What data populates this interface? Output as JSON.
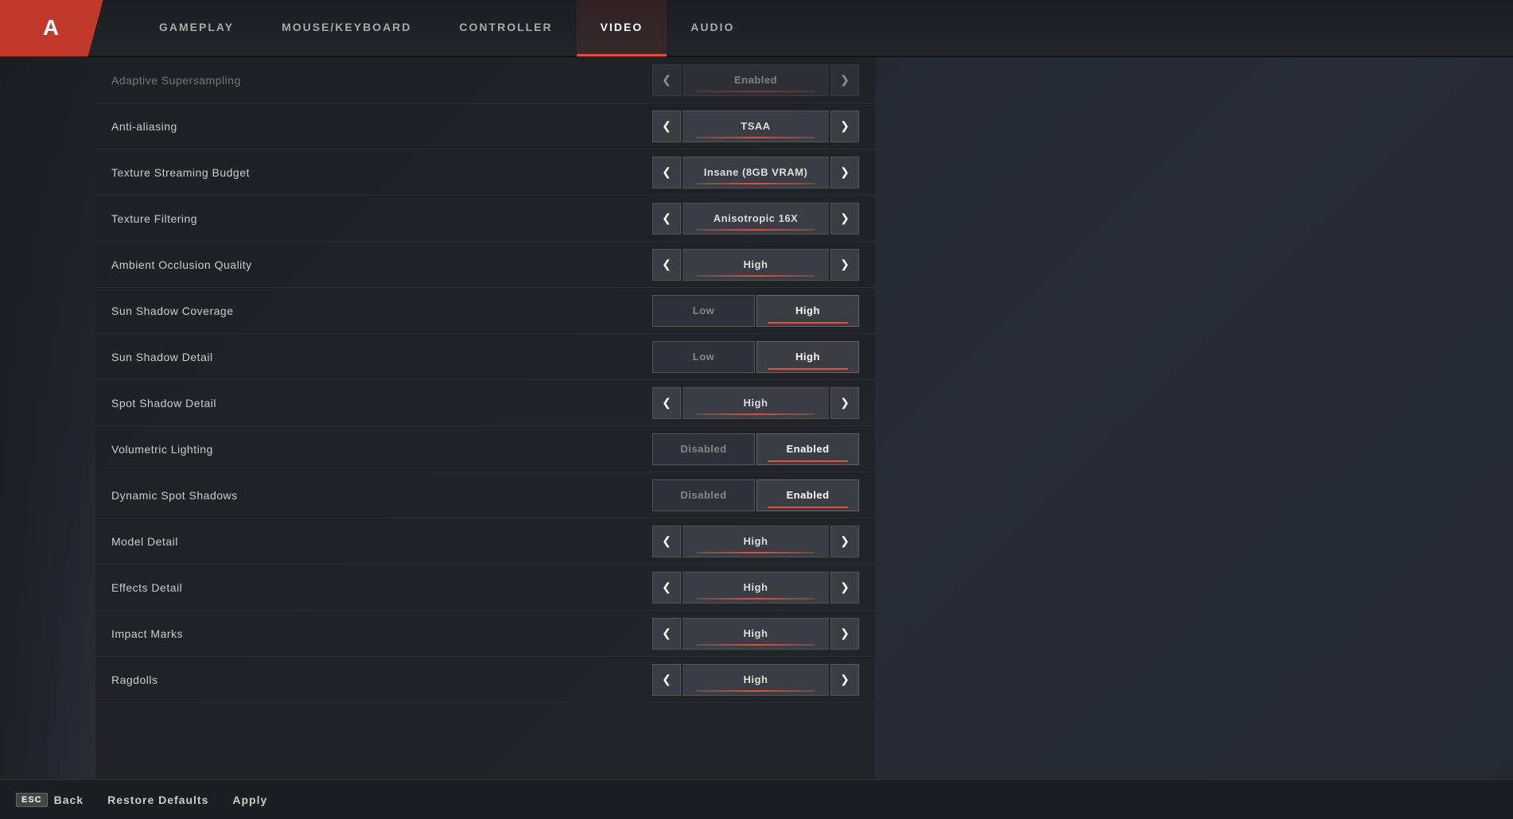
{
  "logo": "A",
  "nav": {
    "tabs": [
      {
        "label": "GAMEPLAY",
        "active": false
      },
      {
        "label": "MOUSE/KEYBOARD",
        "active": false
      },
      {
        "label": "CONTROLLER",
        "active": false
      },
      {
        "label": "VIDEO",
        "active": true
      },
      {
        "label": "AUDIO",
        "active": false
      }
    ]
  },
  "settings": {
    "rows": [
      {
        "label": "Adaptive Supersampling",
        "type": "arrow",
        "value": "Enabled",
        "faded": true
      },
      {
        "label": "Anti-aliasing",
        "type": "arrow",
        "value": "TSAA"
      },
      {
        "label": "Texture Streaming Budget",
        "type": "arrow",
        "value": "Insane (8GB VRAM)"
      },
      {
        "label": "Texture Filtering",
        "type": "arrow",
        "value": "Anisotropic 16X"
      },
      {
        "label": "Ambient Occlusion Quality",
        "type": "arrow",
        "value": "High"
      },
      {
        "label": "Sun Shadow Coverage",
        "type": "toggle",
        "options": [
          "Low",
          "High"
        ],
        "active": "High"
      },
      {
        "label": "Sun Shadow Detail",
        "type": "toggle",
        "options": [
          "Low",
          "High"
        ],
        "active": "High"
      },
      {
        "label": "Spot Shadow Detail",
        "type": "arrow",
        "value": "High"
      },
      {
        "label": "Volumetric Lighting",
        "type": "toggle",
        "options": [
          "Disabled",
          "Enabled"
        ],
        "active": "Enabled"
      },
      {
        "label": "Dynamic Spot Shadows",
        "type": "toggle",
        "options": [
          "Disabled",
          "Enabled"
        ],
        "active": "Enabled"
      },
      {
        "label": "Model Detail",
        "type": "arrow",
        "value": "High"
      },
      {
        "label": "Effects Detail",
        "type": "arrow",
        "value": "High"
      },
      {
        "label": "Impact Marks",
        "type": "arrow",
        "value": "High"
      },
      {
        "label": "Ragdolls",
        "type": "arrow",
        "value": "High"
      }
    ]
  },
  "bottom": {
    "esc_key": "ESC",
    "back_label": "Back",
    "restore_label": "Restore Defaults",
    "apply_label": "Apply"
  }
}
